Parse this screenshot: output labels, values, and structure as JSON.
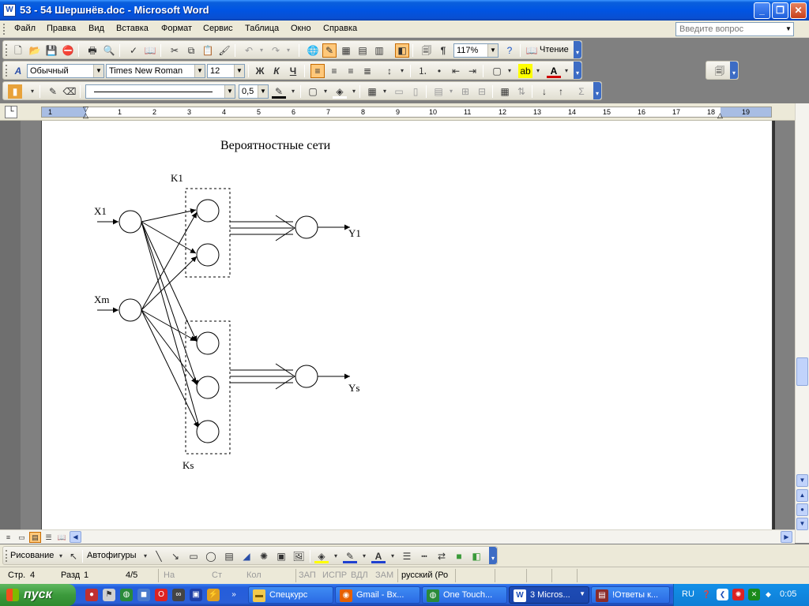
{
  "window": {
    "title": "53 - 54 Шершнёв.doc - Microsoft Word",
    "app_icon": "word-doc-icon",
    "buttons": {
      "minimize": "_",
      "restore": "❐",
      "close": "✕"
    }
  },
  "menu": {
    "items": [
      "Файл",
      "Правка",
      "Вид",
      "Вставка",
      "Формат",
      "Сервис",
      "Таблица",
      "Окно",
      "Справка"
    ],
    "help_placeholder": "Введите вопрос"
  },
  "standard_toolbar": {
    "zoom": "117%",
    "reading_label": "Чтение"
  },
  "formatting_toolbar": {
    "style": "Обычный",
    "font": "Times New Roman",
    "size": "12",
    "bold": "Ж",
    "italic": "К",
    "underline": "Ч"
  },
  "tables_toolbar": {
    "line_weight": "0,5"
  },
  "ruler": {
    "left_numbers": [
      "1"
    ],
    "numbers": [
      "1",
      "2",
      "3",
      "4",
      "5",
      "6",
      "7",
      "8",
      "9",
      "10",
      "11",
      "12",
      "13",
      "14",
      "15",
      "16",
      "17",
      "18",
      "19"
    ]
  },
  "document": {
    "title": "Вероятностные сети",
    "diagram_labels": {
      "k1": "K1",
      "ks": "Ks",
      "x1": "X1",
      "xm": "Xm",
      "y1": "Y1",
      "ys": "Ys"
    }
  },
  "drawing_toolbar": {
    "drawing_label": "Рисование",
    "autoshapes_label": "Автофигуры"
  },
  "status": {
    "page": "Стр.",
    "page_num": "4",
    "section": "Разд",
    "section_num": "1",
    "pages": "4/5",
    "at": "На",
    "line": "Ст",
    "col": "Кол",
    "rec": "ЗАП",
    "trk": "ИСПР",
    "ext": "ВДЛ",
    "ovr": "ЗАМ",
    "lang": "русский (Ро"
  },
  "taskbar": {
    "start": "пуск",
    "tasks": [
      "Спецкурс",
      "Gmail - Вх...",
      "One Touch...",
      "3 Micros...",
      "!Ответы к..."
    ],
    "lang": "RU",
    "clock": "0:05"
  }
}
